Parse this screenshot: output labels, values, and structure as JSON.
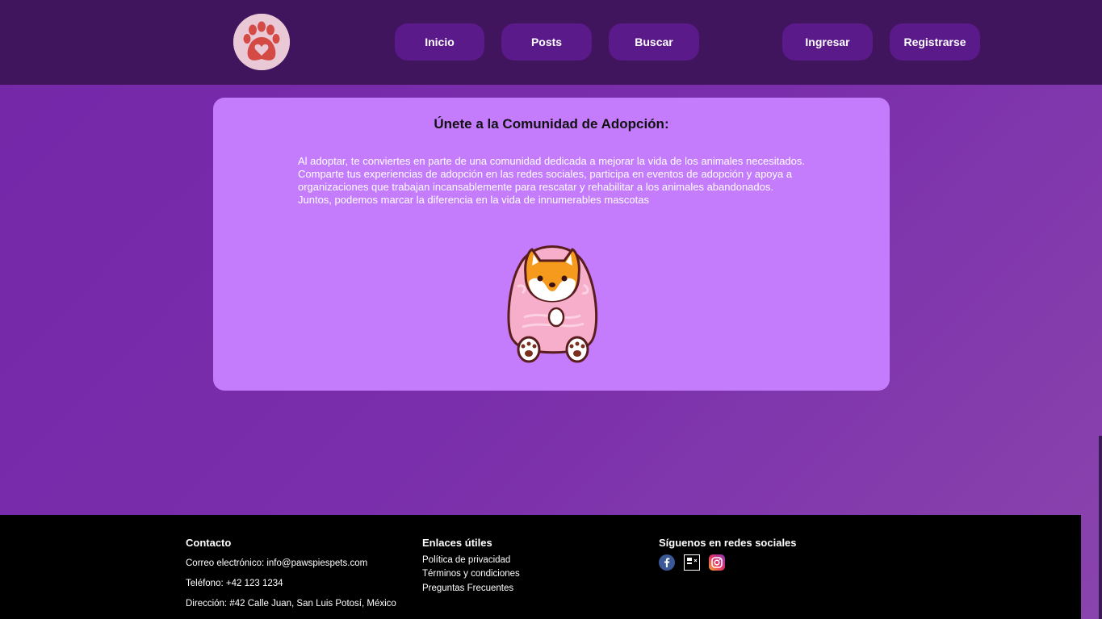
{
  "nav": {
    "items": [
      {
        "label": "Inicio"
      },
      {
        "label": "Posts"
      },
      {
        "label": "Buscar"
      },
      {
        "label": "Ingresar"
      },
      {
        "label": "Registrarse"
      }
    ]
  },
  "card": {
    "title": "Únete a la Comunidad de Adopción:",
    "body": "Al adoptar, te conviertes en parte de una comunidad dedicada a mejorar la vida de los animales necesitados. Comparte tus experiencias de adopción en las redes sociales, participa en eventos de adopción y apoya a organizaciones que trabajan incansablemente para rescatar y rehabilitar a los animales abandonados. Juntos, podemos marcar la diferencia en la vida de innumerables mascotas"
  },
  "footer": {
    "contact": {
      "heading": "Contacto",
      "email": "Correo electrónico: info@pawspiespets.com",
      "phone": "Teléfono: +42 123 1234",
      "address": "Dirección: #42 Calle Juan, San Luis Potosí, México"
    },
    "links": {
      "heading": "Enlaces útiles",
      "items": [
        "Política de privacidad",
        "Términos y condiciones",
        "Preguntas Frecuentes"
      ]
    },
    "social": {
      "heading": "Síguenos en redes sociales",
      "icons": [
        "facebook-icon",
        "x-icon",
        "instagram-icon"
      ]
    }
  },
  "colors": {
    "header": "#41145e",
    "nav_button": "#5a1a8a",
    "card": "#c47cfd",
    "footer": "#000000"
  }
}
